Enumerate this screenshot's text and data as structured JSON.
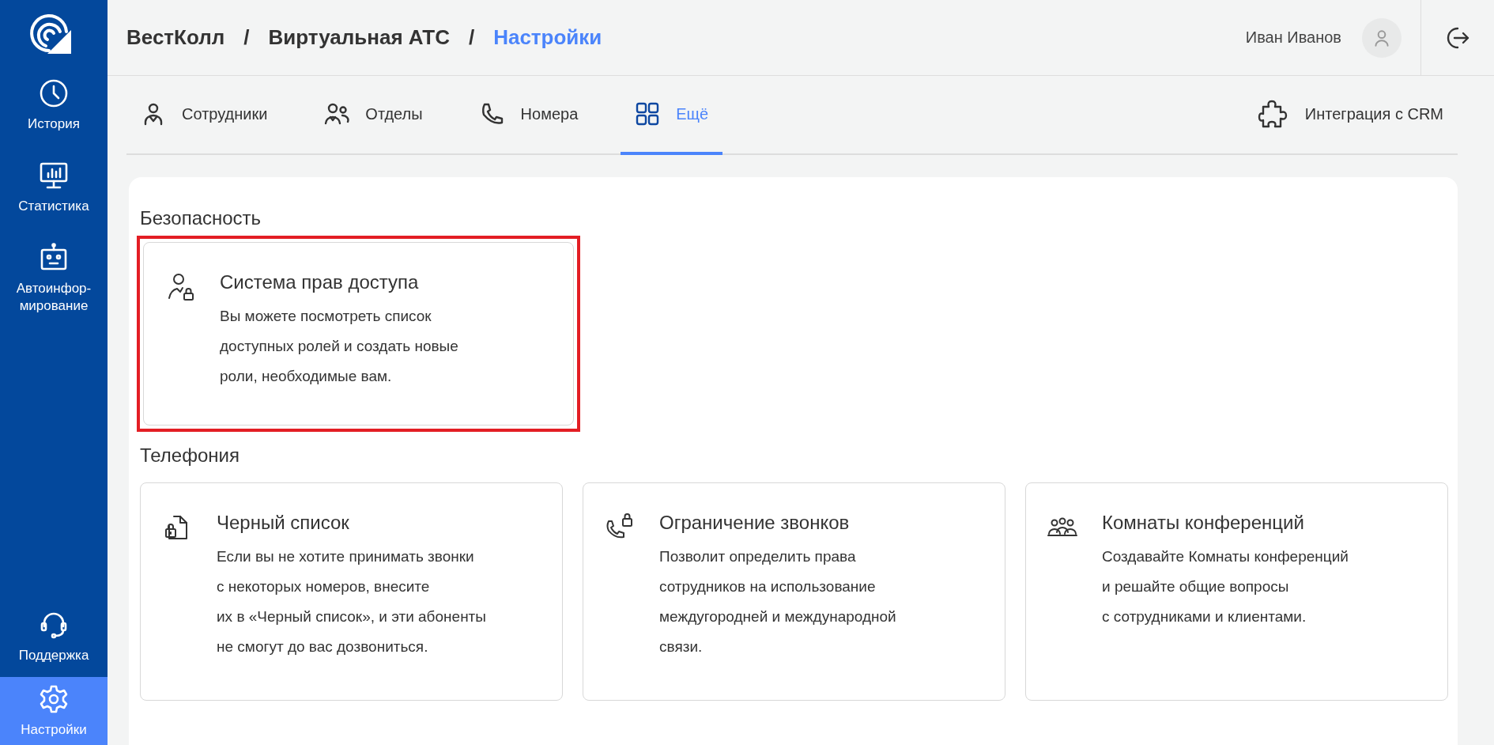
{
  "sidebar": {
    "items": [
      {
        "kind": "history",
        "label": "История",
        "selected": false
      },
      {
        "kind": "stats",
        "label": "Статистика",
        "selected": false
      },
      {
        "kind": "robot",
        "label": "Автоинфор-\nмирование",
        "selected": false
      }
    ],
    "bottom_items": [
      {
        "kind": "support",
        "label": "Поддержка",
        "selected": false
      },
      {
        "kind": "settings",
        "label": "Настройки",
        "selected": true
      }
    ]
  },
  "breadcrumbs": [
    {
      "label": "ВестКолл",
      "current": false
    },
    {
      "label": "Виртуальная АТС",
      "current": false
    },
    {
      "label": "Настройки",
      "current": true
    }
  ],
  "breadcrumb_separator": "/",
  "user": {
    "name": "Иван Иванов"
  },
  "tabs": [
    {
      "kind": "person",
      "label": "Сотрудники",
      "selected": false
    },
    {
      "kind": "people",
      "label": "Отделы",
      "selected": false
    },
    {
      "kind": "phone",
      "label": "Номера",
      "selected": false
    },
    {
      "kind": "grid",
      "label": "Ещё",
      "selected": true
    }
  ],
  "integration_tab": {
    "label": "Интеграция с CRM",
    "selected": false
  },
  "sections": [
    {
      "title": "Безопасность",
      "cards": [
        {
          "kind": "access",
          "title": "Система прав доступа",
          "description": "Вы можете посмотреть список\nдоступных ролей и создать новые\nроли, необходимые вам.",
          "highlighted": true
        }
      ]
    },
    {
      "title": "Телефония",
      "cards": [
        {
          "kind": "blacklist",
          "title": "Черный список",
          "description": "Если вы не хотите принимать звонки\nс некоторых номеров, внесите\nих в «Черный список», и эти абоненты\nне смогут до вас дозвониться.",
          "highlighted": false
        },
        {
          "kind": "restrict",
          "title": "Ограничение звонков",
          "description": "Позволит определить права\nсотрудников на использование\nмеждугородней и международной\nсвязи.",
          "highlighted": false
        },
        {
          "kind": "conference",
          "title": "Комнаты конференций",
          "description": "Создавайте Комнаты конференций\nи решайте общие вопросы\nс сотрудниками и клиентами.",
          "highlighted": false
        }
      ]
    }
  ]
}
